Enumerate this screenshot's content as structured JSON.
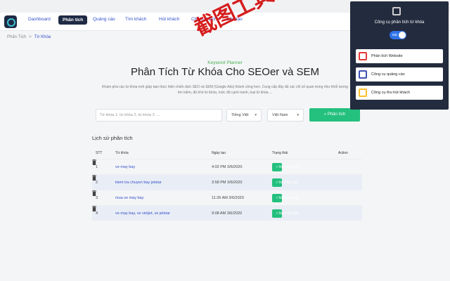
{
  "nav": {
    "items": [
      {
        "label": "Dashboard",
        "active": false
      },
      {
        "label": "Phân tích",
        "active": true
      },
      {
        "label": "Quảng cáo",
        "active": false
      },
      {
        "label": "Tìm khách",
        "active": false
      },
      {
        "label": "Hút khách",
        "active": false
      },
      {
        "label": "Chăm khách",
        "active": false
      },
      {
        "label": "Đào tạo",
        "active": false
      }
    ]
  },
  "breadcrumb": {
    "root": "Phân Tích",
    "separator": ">",
    "current": "Từ Khóa"
  },
  "hero": {
    "kicker": "Keyword Planner",
    "title": "Phân Tích Từ Khóa Cho SEOer và SEM",
    "description": "Khám phá các từ khóa mới giúp bạn thực hiện chiến dịch SEO và SEM (Google Ads) thành công hơn. Cung cấp đầy đủ các chỉ số quan trọng như khối lượng tìm kiếm, độ khó từ khóa, mức độ cạnh tranh, loại từ khóa ..."
  },
  "search": {
    "placeholder": "Từ khóa 1, từ khóa 2, từ khóa 3 ....",
    "language": "Tiếng Việt",
    "country": "Việt Nam",
    "button": "Phân tích"
  },
  "history": {
    "title": "Lịch sử phân tích",
    "columns": {
      "stt": "STT",
      "keyword": "Từ khóa",
      "date": "Ngày tạo",
      "status": "Trạng thái",
      "action": "Action"
    },
    "rows": [
      {
        "stt": "1",
        "keyword": "ve may bay",
        "date": "4:02 PM 3/6/2020",
        "status": "Xem kết quả"
      },
      {
        "stt": "2",
        "keyword": "kiem tra chuyen bay jetstar",
        "date": "3:58 PM 3/6/2020",
        "status": "Xem kết quả"
      },
      {
        "stt": "3",
        "keyword": "mua ve may bay",
        "date": "11:26 AM 3/6/2020",
        "status": "Xem kết quả"
      },
      {
        "stt": "4",
        "keyword": "ve may bay, ve vietjet, ve jetstar",
        "date": "9:08 AM 3/6/2020",
        "status": "Xem kết quả"
      }
    ]
  },
  "watermark": {
    "line1": "截图工具scs66"
  },
  "popup": {
    "title": "Công cụ phân tích từ khóa",
    "toggle_label": "Bật",
    "toggle_on": true,
    "items": [
      {
        "label": "Phân tích Website",
        "icon": "website-analysis-icon",
        "color": "#e53935"
      },
      {
        "label": "Công cụ quảng cáo",
        "icon": "ads-tool-icon",
        "color": "#3f51b5"
      },
      {
        "label": "Công cụ thu hút khách",
        "icon": "customer-attract-icon",
        "color": "#fbc02d"
      }
    ]
  },
  "colors": {
    "accent_green": "#23c07e",
    "nav_active": "#1f2a44",
    "link_blue": "#3450c9",
    "popup_bg": "#232b3e"
  }
}
